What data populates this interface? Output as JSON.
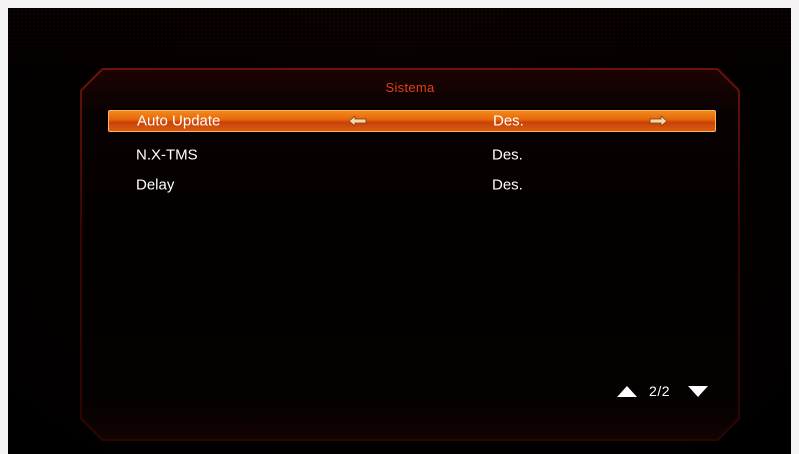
{
  "panel": {
    "title": "Sistema"
  },
  "menu": {
    "items": [
      {
        "label": "Auto Update",
        "value": "Des.",
        "selected": true
      },
      {
        "label": "N.X-TMS",
        "value": "Des.",
        "selected": false
      },
      {
        "label": "Delay",
        "value": "Des.",
        "selected": false
      }
    ]
  },
  "pager": {
    "text": "2/2"
  },
  "colors": {
    "title": "#e0401a",
    "highlight": "#e8640a",
    "frame": "#6a1208",
    "text": "#ffffff"
  },
  "icons": {
    "left": "arrow-left-icon",
    "right": "arrow-right-icon",
    "up": "triangle-up-icon",
    "down": "triangle-down-icon"
  }
}
